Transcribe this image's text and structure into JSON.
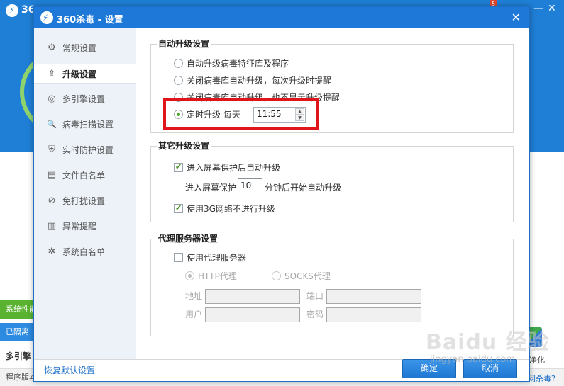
{
  "background": {
    "brand": "36",
    "badge": "5",
    "green_bar": "系统性能",
    "blue_bar": "已隔离",
    "engine_label": "多引擎",
    "version_label": "程序版本",
    "cleanup_label": "净化",
    "question_link": "网杀毒?"
  },
  "dialog": {
    "title": "360杀毒 - 设置",
    "close_glyph": "✕"
  },
  "sidebar": {
    "items": [
      {
        "label": "常规设置",
        "icon": "gear-icon",
        "glyph": "⚙"
      },
      {
        "label": "升级设置",
        "icon": "upgrade-icon",
        "glyph": "⇪"
      },
      {
        "label": "多引擎设置",
        "icon": "engine-icon",
        "glyph": "◎"
      },
      {
        "label": "病毒扫描设置",
        "icon": "search-icon",
        "glyph": "🔍"
      },
      {
        "label": "实时防护设置",
        "icon": "shield-icon",
        "glyph": "⛨"
      },
      {
        "label": "文件白名单",
        "icon": "file-icon",
        "glyph": "▤"
      },
      {
        "label": "免打扰设置",
        "icon": "do-not-disturb-icon",
        "glyph": "⊘"
      },
      {
        "label": "异常提醒",
        "icon": "chart-icon",
        "glyph": "▥"
      },
      {
        "label": "系统白名单",
        "icon": "tools-icon",
        "glyph": "✲"
      }
    ],
    "active_index": 1
  },
  "auto_upgrade": {
    "title": "自动升级设置",
    "options": [
      "自动升级病毒特征库及程序",
      "关闭病毒库自动升级，每次升级时提醒",
      "关闭病毒库自动升级，也不显示升级提醒",
      "定时升级 每天"
    ],
    "selected_index": 3,
    "time_value": "11:55"
  },
  "other_upgrade": {
    "title": "其它升级设置",
    "screensaver_label": "进入屏幕保护后自动升级",
    "screensaver_checked": true,
    "delay_prefix": "进入屏幕保护",
    "delay_value": "10",
    "delay_suffix": "分钟后开始自动升级",
    "no3g_label": "使用3G网络不进行升级",
    "no3g_checked": true
  },
  "proxy": {
    "title": "代理服务器设置",
    "use_proxy_label": "使用代理服务器",
    "use_proxy_checked": false,
    "types": [
      "HTTP代理",
      "SOCKS代理"
    ],
    "selected_type": 0,
    "address_label": "地址",
    "port_label": "端口",
    "user_label": "用户",
    "password_label": "密码",
    "address_value": "",
    "port_value": "",
    "user_value": "",
    "password_value": ""
  },
  "footer": {
    "restore_label": "恢复默认设置",
    "ok_label": "确定",
    "cancel_label": "取消"
  },
  "watermark": {
    "text": "Baidu 经验",
    "sub": "jingyan.baidu.com"
  }
}
